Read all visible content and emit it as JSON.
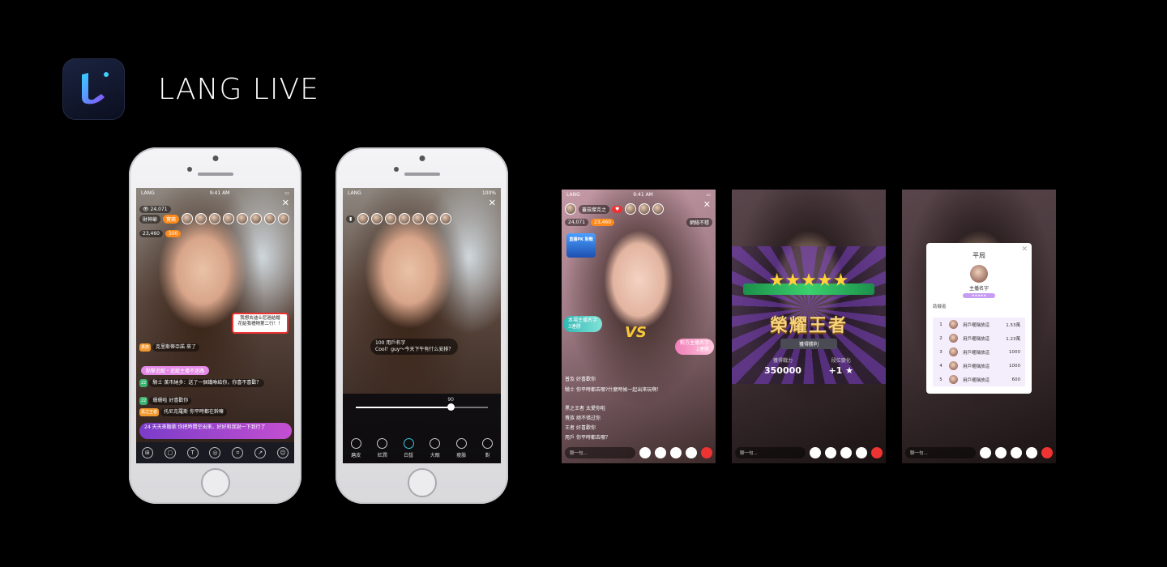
{
  "brand": {
    "name": "LANG LIVE"
  },
  "phone1": {
    "status_left": "LANG",
    "status_time": "9:41 AM",
    "viewers": "24,071",
    "badge_left": "財神爺",
    "badge_right": "寶箱",
    "coins": "23,460",
    "gift_text_1": "我想去迪士尼過結婚",
    "gift_text_2": "花給我禮物第二行！！",
    "chat": [
      {
        "tag": "貴族",
        "name": "克里斯蒂亞諾",
        "text": "來了"
      },
      {
        "tag": "22",
        "name": "騎士",
        "text": "萊市納多：送了一個鐵咻給你，你喜不喜歡？"
      },
      {
        "tag": "22",
        "name": "珊珊啦",
        "text": "好喜歡你"
      },
      {
        "tag": "黑之王者",
        "name": "托尼克羅斯",
        "text": "你平時都在幹嘛"
      },
      {
        "tag": "24",
        "name": "天天來聽歌",
        "text": "你把時間空出來，好好和我說一下我行了"
      }
    ],
    "follow": "點擊追蹤・追蹤主播不迷路",
    "tools": [
      "更多",
      "訊息",
      "文字",
      "禮物",
      "裁剪",
      "分享",
      "用戶"
    ]
  },
  "phone2": {
    "status_left": "LANG",
    "battery": "100%",
    "comment_name": "用戶名字",
    "comment_level": "100",
    "comment_text": "Cool！guy～今天下午有什么安排？",
    "slider_value": "90",
    "slider_level": 0.72,
    "beauty": [
      "磨皮",
      "紅潤",
      "白皙",
      "大眼",
      "瘦臉",
      "對"
    ]
  },
  "shot1": {
    "status_left": "LANG",
    "status_time": "9:41 AM",
    "host_name": "蓋茲傑克之",
    "viewers": "24,071",
    "coins": "23,460",
    "gift_label": "網絡不穩",
    "pk_badge": "直播PK 對戰",
    "left_host": "本場主播名字",
    "left_wins": "3連勝",
    "right_host": "對方主播名字",
    "right_wins": "2連勝",
    "vs": "VS",
    "chat": [
      {
        "tag": "普及",
        "text": "好喜歡你"
      },
      {
        "tag": "騎士",
        "text": "你平時都去哪?什麼時候一起出來玩啊！"
      },
      {
        "tag": "黑之王者",
        "text": "太愛你啦"
      },
      {
        "tag": "貴族",
        "text": "絕不错过你"
      },
      {
        "tag": "王者",
        "text": "好喜歡你"
      },
      {
        "tag": "用戶",
        "text": "你平時都去哪？"
      }
    ],
    "input_placeholder": "聊一句..."
  },
  "shot2": {
    "title": "榮耀王者",
    "subtitle": "獲得勝利",
    "stat1_label": "獲得戰力",
    "stat1_value": "350000",
    "stat2_label": "段位變化",
    "stat2_value": "+1 ★",
    "stars": "★★★★★"
  },
  "shot3": {
    "modal_title": "平局",
    "host_name": "主播名字",
    "contributors_label": "助戰者",
    "ranks": [
      {
        "n": "1",
        "name": "用戶暱稱放這",
        "value": "1.53萬"
      },
      {
        "n": "2",
        "name": "用戶暱稱放這",
        "value": "1.23萬"
      },
      {
        "n": "3",
        "name": "用戶暱稱放這",
        "value": "1000"
      },
      {
        "n": "4",
        "name": "用戶暱稱放這",
        "value": "1000"
      },
      {
        "n": "5",
        "name": "用戶暱稱放這",
        "value": "600"
      }
    ]
  }
}
